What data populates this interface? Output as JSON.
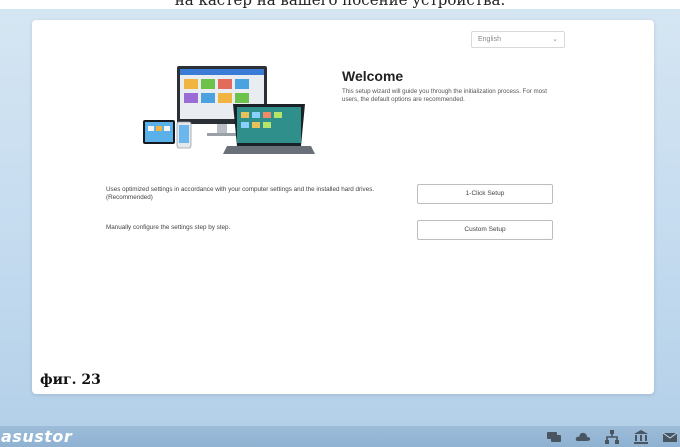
{
  "top_caption": "на кастер на вашего посение устройства.",
  "language_select": {
    "value": "English"
  },
  "welcome": {
    "title": "Welcome",
    "description": "This setup wizard will guide you through the initialization process. For most users, the default options are recommended."
  },
  "options": [
    {
      "description": "Uses optimized settings in accordance with your computer settings and the installed hard drives. (Recommended)",
      "button": "1-Click Setup"
    },
    {
      "description": "Manually configure the settings step by step.",
      "button": "Custom Setup"
    }
  ],
  "figure_caption": "фиг. 23",
  "brand": {
    "logo_text": "asustor"
  },
  "taskbar_icons": [
    "chat-icon",
    "cloud-icon",
    "network-icon",
    "building-icon",
    "mail-icon"
  ],
  "colors": {
    "background": "#c4dbef",
    "taskbar": "#8fb2d2",
    "icon": "#4a5562"
  }
}
